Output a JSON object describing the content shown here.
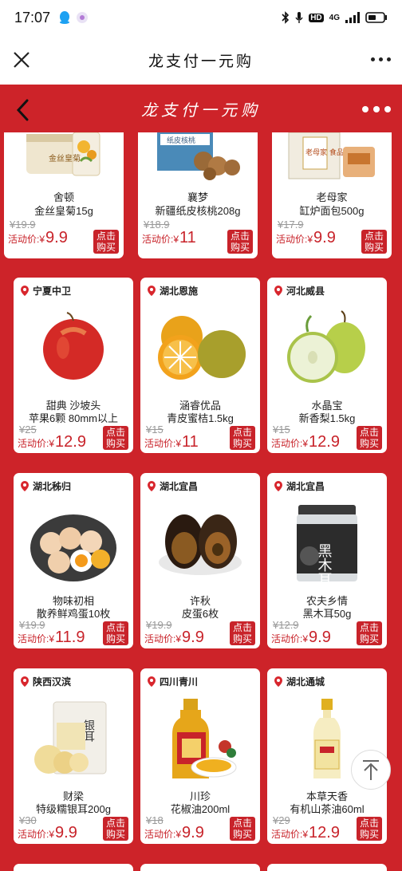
{
  "status_bar": {
    "time": "17:07",
    "network_label": "HD",
    "signal_label": "4G"
  },
  "app_bar": {
    "title": "龙支付一元购"
  },
  "header": {
    "title": "龙支付一元购"
  },
  "colors": {
    "brand_red": "#cd2329",
    "price_red": "#c8232a"
  },
  "labels": {
    "activity_price": "活动价:",
    "currency": "¥",
    "buy_line1": "点击",
    "buy_line2": "购买"
  },
  "rows": [
    [
      {
        "location": "",
        "brand": "舍顿",
        "name": "金丝皇菊15g",
        "old_price": "¥19.9",
        "price": "9.9"
      },
      {
        "location": "",
        "brand": "襄梦",
        "name": "新疆纸皮核桃208g",
        "old_price": "¥18.9",
        "price": "11"
      },
      {
        "location": "",
        "brand": "老母家",
        "name": "缸炉面包500g",
        "old_price": "¥17.9",
        "price": "9.9"
      }
    ],
    [
      {
        "location": "宁夏中卫",
        "brand": "甜典 沙坡头",
        "name": "苹果6颗 80mm以上",
        "old_price": "¥25",
        "price": "12.9"
      },
      {
        "location": "湖北恩施",
        "brand": "涵睿优品",
        "name": "青皮蜜桔1.5kg",
        "old_price": "¥15",
        "price": "11"
      },
      {
        "location": "河北威县",
        "brand": "水晶宝",
        "name": "新香梨1.5kg",
        "old_price": "¥15",
        "price": "12.9"
      }
    ],
    [
      {
        "location": "湖北秭归",
        "brand": "物味初相",
        "name": "散养鲜鸡蛋10枚",
        "old_price": "¥19.9",
        "price": "11.9"
      },
      {
        "location": "湖北宜昌",
        "brand": "许秋",
        "name": "皮蛋6枚",
        "old_price": "¥19.9",
        "price": "9.9"
      },
      {
        "location": "湖北宜昌",
        "brand": "农夫乡情",
        "name": "黑木耳50g",
        "old_price": "¥12.9",
        "price": "9.9"
      }
    ],
    [
      {
        "location": "陕西汉滨",
        "brand": "财梁",
        "name": "特级糯银耳200g",
        "old_price": "¥30",
        "price": "9.9"
      },
      {
        "location": "四川青川",
        "brand": "川珍",
        "name": "花椒油200ml",
        "old_price": "¥18",
        "price": "9.9"
      },
      {
        "location": "湖北通城",
        "brand": "本草天香",
        "name": "有机山茶油60ml",
        "old_price": "¥29",
        "price": "12.9"
      }
    ]
  ],
  "product_art": {
    "r1c1": {
      "packaging_text": "金丝皇菊"
    },
    "r1c2": {
      "packaging_text": "纸皮核桃"
    },
    "r1c3": {
      "packaging_text": "老母家 食品"
    },
    "r3c3": {
      "packaging_text": "黑木耳"
    },
    "r4c1": {
      "packaging_text": "银耳"
    }
  }
}
